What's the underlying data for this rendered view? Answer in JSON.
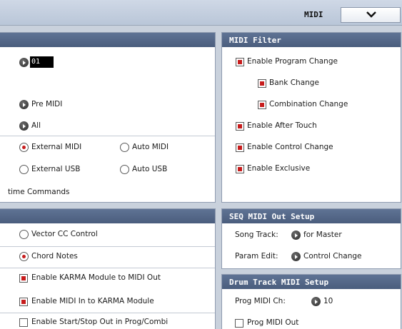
{
  "header": {
    "mode_title": "MIDI"
  },
  "left_top": {
    "channel_value": "01",
    "pre_midi": "Pre MIDI",
    "all": "All",
    "external_midi": "External MIDI",
    "auto_midi": "Auto MIDI",
    "external_usb": "External USB",
    "auto_usb": "Auto USB",
    "realtime_commands": "time Commands"
  },
  "midi_filter": {
    "title": "MIDI Filter",
    "enable_program_change": "Enable Program Change",
    "bank_change": "Bank Change",
    "combination_change": "Combination Change",
    "enable_after_touch": "Enable After Touch",
    "enable_control_change": "Enable Control Change",
    "enable_exclusive": "Enable Exclusive"
  },
  "left_bottom": {
    "vector_cc_control": "Vector CC Control",
    "chord_notes": "Chord Notes",
    "enable_karma_to_midi_out": "Enable KARMA Module to MIDI Out",
    "enable_midi_in_to_karma": "Enable MIDI In to KARMA Module",
    "enable_start_stop_out": "Enable Start/Stop Out in Prog/Combi"
  },
  "seq_midi_out": {
    "title": "SEQ MIDI Out Setup",
    "song_track_label": "Song Track:",
    "song_track_value": "for Master",
    "param_edit_label": "Param Edit:",
    "param_edit_value": "Control Change"
  },
  "drum_track": {
    "title": "Drum Track MIDI Setup",
    "prog_midi_ch_label": "Prog MIDI Ch:",
    "prog_midi_ch_value": "10",
    "prog_midi_out": "Prog MIDI Out"
  },
  "colors": {
    "panel_header": "#4f6282",
    "checked_indicator": "#c71c1c",
    "background": "#c9d1dc"
  }
}
